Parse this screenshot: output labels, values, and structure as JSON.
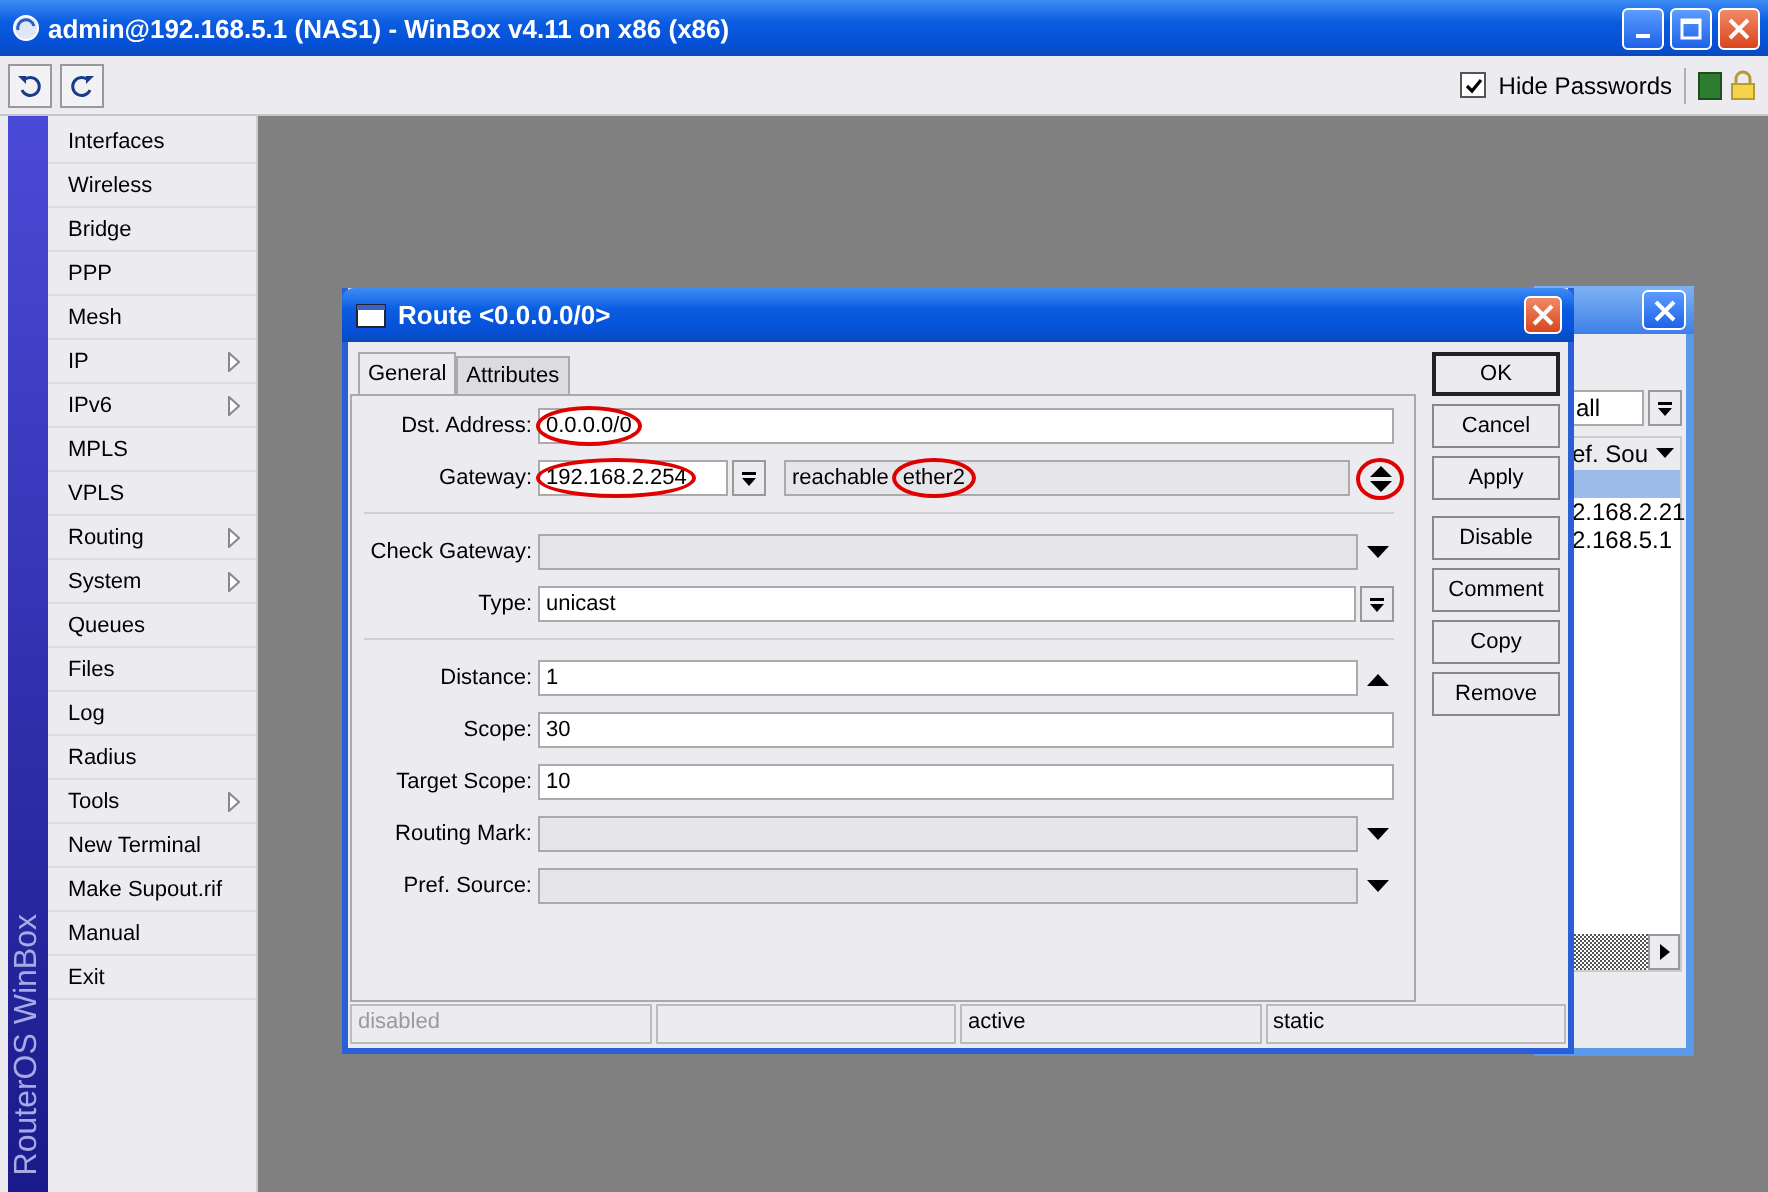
{
  "window": {
    "title": "admin@192.168.5.1 (NAS1) - WinBox v4.11 on x86 (x86)"
  },
  "toolbar": {
    "hide_passwords": {
      "label": "Hide Passwords",
      "checked": true
    }
  },
  "sidebar": {
    "brand": "RouterOS WinBox",
    "items": [
      {
        "label": "Interfaces",
        "submenu": false
      },
      {
        "label": "Wireless",
        "submenu": false
      },
      {
        "label": "Bridge",
        "submenu": false
      },
      {
        "label": "PPP",
        "submenu": false
      },
      {
        "label": "Mesh",
        "submenu": false
      },
      {
        "label": "IP",
        "submenu": true
      },
      {
        "label": "IPv6",
        "submenu": true
      },
      {
        "label": "MPLS",
        "submenu": false
      },
      {
        "label": "VPLS",
        "submenu": false
      },
      {
        "label": "Routing",
        "submenu": true
      },
      {
        "label": "System",
        "submenu": true
      },
      {
        "label": "Queues",
        "submenu": false
      },
      {
        "label": "Files",
        "submenu": false
      },
      {
        "label": "Log",
        "submenu": false
      },
      {
        "label": "Radius",
        "submenu": false
      },
      {
        "label": "Tools",
        "submenu": true
      },
      {
        "label": "New Terminal",
        "submenu": false
      },
      {
        "label": "Make Supout.rif",
        "submenu": false
      },
      {
        "label": "Manual",
        "submenu": false
      },
      {
        "label": "Exit",
        "submenu": false
      }
    ]
  },
  "background_window": {
    "filter": "all",
    "column": "ef. Sou",
    "rows": [
      {
        "selected": true
      },
      {
        "text": "2.168.2.21",
        "selected": false
      },
      {
        "text": "2.168.5.1",
        "selected": false
      }
    ]
  },
  "dialog": {
    "title": "Route <0.0.0.0/0>",
    "tabs": [
      {
        "label": "General",
        "selected": true
      },
      {
        "label": "Attributes",
        "selected": false
      }
    ],
    "sections": [
      [
        {
          "kind": "plain",
          "label": "Dst. Address:",
          "value": "0.0.0.0/0",
          "disabled": false,
          "highlighted": true
        },
        {
          "kind": "gateway",
          "label": "Gateway:",
          "value": "192.168.2.254",
          "disabled": false,
          "highlighted": true,
          "status": "reachable",
          "interface": "ether2",
          "interface_highlighted": true,
          "arrows_highlighted": true
        }
      ],
      [
        {
          "kind": "dropdown",
          "label": "Check Gateway:",
          "disabled": true
        },
        {
          "kind": "combo",
          "label": "Type:",
          "value": "unicast",
          "disabled": false,
          "highlighted": false
        }
      ],
      [
        {
          "kind": "up",
          "label": "Distance:",
          "value": "1",
          "disabled": false,
          "highlighted": false
        },
        {
          "kind": "plain",
          "label": "Scope:",
          "value": "30",
          "disabled": false,
          "highlighted": false
        },
        {
          "kind": "plain",
          "label": "Target Scope:",
          "value": "10",
          "disabled": false,
          "highlighted": false
        },
        {
          "kind": "dropdown",
          "label": "Routing Mark:",
          "disabled": true
        },
        {
          "kind": "dropdown",
          "label": "Pref. Source:",
          "disabled": true
        }
      ]
    ],
    "button_groups": [
      [
        {
          "label": "OK",
          "default": true
        },
        {
          "label": "Cancel",
          "default": false
        },
        {
          "label": "Apply",
          "default": false
        }
      ],
      [
        {
          "label": "Disable",
          "default": false
        },
        {
          "label": "Comment",
          "default": false
        },
        {
          "label": "Copy",
          "default": false
        },
        {
          "label": "Remove",
          "default": false
        }
      ]
    ],
    "status_bar": [
      {
        "kind": "text",
        "text": "disabled",
        "disabled": true
      },
      {
        "kind": "blank"
      },
      {
        "kind": "text",
        "text": "active",
        "disabled": false
      },
      {
        "kind": "text",
        "text": "static",
        "disabled": false
      }
    ]
  }
}
